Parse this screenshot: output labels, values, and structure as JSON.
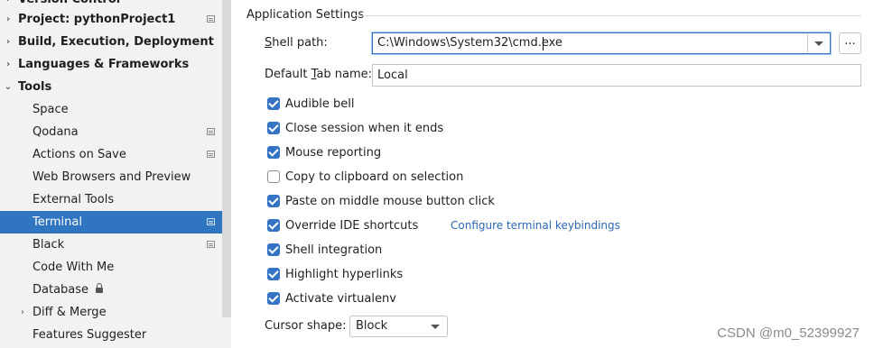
{
  "sidebar": {
    "items": [
      {
        "label": "Version Control",
        "arrow": "›",
        "bold": true
      },
      {
        "label": "Project: pythonProject1",
        "arrow": "›",
        "bold": true,
        "icon": "project-icon"
      },
      {
        "label": "Build, Execution, Deployment",
        "arrow": "›",
        "bold": true
      },
      {
        "label": "Languages & Frameworks",
        "arrow": "›",
        "bold": true
      },
      {
        "label": "Tools",
        "arrow": "⌄",
        "bold": true
      },
      {
        "label": "Space"
      },
      {
        "label": "Qodana",
        "icon": "project-icon"
      },
      {
        "label": "Actions on Save",
        "icon": "project-icon"
      },
      {
        "label": "Web Browsers and Preview"
      },
      {
        "label": "External Tools"
      },
      {
        "label": "Terminal",
        "selected": true,
        "icon": "project-icon"
      },
      {
        "label": "Black",
        "icon": "project-icon"
      },
      {
        "label": "Code With Me"
      },
      {
        "label": "Database",
        "icon": "lock-icon"
      },
      {
        "label": "Diff & Merge",
        "arrow": "›"
      },
      {
        "label": "Features Suggester"
      }
    ]
  },
  "main": {
    "section_title": "Application Settings",
    "shell_path": {
      "label": "Shell path:",
      "mnemonic": "S",
      "rest": "hell path:",
      "value": "C:\\Windows\\System32\\cmd.exe",
      "browse_label": "..."
    },
    "tab_name": {
      "label_before": "Default ",
      "mnemonic": "T",
      "label_after": "ab name:",
      "value": "Local"
    },
    "checkboxes": [
      {
        "label": "Audible bell",
        "checked": true
      },
      {
        "label": "Close session when it ends",
        "checked": true
      },
      {
        "label": "Mouse reporting",
        "checked": true
      },
      {
        "label": "Copy to clipboard on selection",
        "checked": false
      },
      {
        "label": "Paste on middle mouse button click",
        "checked": true
      },
      {
        "label": "Override IDE shortcuts",
        "checked": true,
        "link": "Configure terminal keybindings"
      },
      {
        "label": "Shell integration",
        "checked": true
      },
      {
        "label": "Highlight hyperlinks",
        "checked": true
      },
      {
        "label": "Activate virtualenv",
        "checked": true
      }
    ],
    "cursor_shape": {
      "label": "Cursor shape:",
      "value": "Block"
    }
  },
  "watermark": "CSDN @m0_52399927",
  "colors": {
    "selection": "#2f75bf",
    "accent": "#3574c4",
    "link": "#2a67b4"
  }
}
